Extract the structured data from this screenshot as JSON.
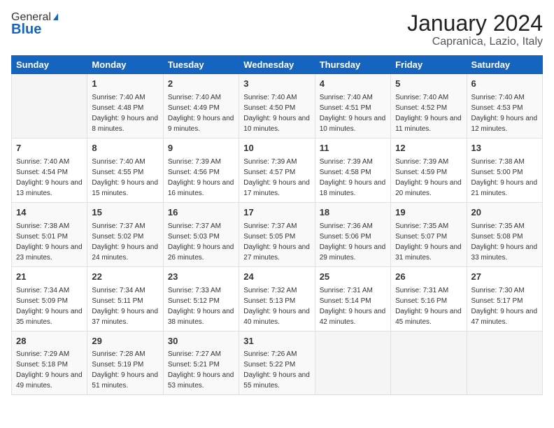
{
  "logo": {
    "general": "General",
    "blue": "Blue"
  },
  "header": {
    "month": "January 2024",
    "location": "Capranica, Lazio, Italy"
  },
  "days_of_week": [
    "Sunday",
    "Monday",
    "Tuesday",
    "Wednesday",
    "Thursday",
    "Friday",
    "Saturday"
  ],
  "weeks": [
    [
      {
        "day": "",
        "sunrise": "",
        "sunset": "",
        "daylight": ""
      },
      {
        "day": "1",
        "sunrise": "Sunrise: 7:40 AM",
        "sunset": "Sunset: 4:48 PM",
        "daylight": "Daylight: 9 hours and 8 minutes."
      },
      {
        "day": "2",
        "sunrise": "Sunrise: 7:40 AM",
        "sunset": "Sunset: 4:49 PM",
        "daylight": "Daylight: 9 hours and 9 minutes."
      },
      {
        "day": "3",
        "sunrise": "Sunrise: 7:40 AM",
        "sunset": "Sunset: 4:50 PM",
        "daylight": "Daylight: 9 hours and 10 minutes."
      },
      {
        "day": "4",
        "sunrise": "Sunrise: 7:40 AM",
        "sunset": "Sunset: 4:51 PM",
        "daylight": "Daylight: 9 hours and 10 minutes."
      },
      {
        "day": "5",
        "sunrise": "Sunrise: 7:40 AM",
        "sunset": "Sunset: 4:52 PM",
        "daylight": "Daylight: 9 hours and 11 minutes."
      },
      {
        "day": "6",
        "sunrise": "Sunrise: 7:40 AM",
        "sunset": "Sunset: 4:53 PM",
        "daylight": "Daylight: 9 hours and 12 minutes."
      }
    ],
    [
      {
        "day": "7",
        "sunrise": "Sunrise: 7:40 AM",
        "sunset": "Sunset: 4:54 PM",
        "daylight": "Daylight: 9 hours and 13 minutes."
      },
      {
        "day": "8",
        "sunrise": "Sunrise: 7:40 AM",
        "sunset": "Sunset: 4:55 PM",
        "daylight": "Daylight: 9 hours and 15 minutes."
      },
      {
        "day": "9",
        "sunrise": "Sunrise: 7:39 AM",
        "sunset": "Sunset: 4:56 PM",
        "daylight": "Daylight: 9 hours and 16 minutes."
      },
      {
        "day": "10",
        "sunrise": "Sunrise: 7:39 AM",
        "sunset": "Sunset: 4:57 PM",
        "daylight": "Daylight: 9 hours and 17 minutes."
      },
      {
        "day": "11",
        "sunrise": "Sunrise: 7:39 AM",
        "sunset": "Sunset: 4:58 PM",
        "daylight": "Daylight: 9 hours and 18 minutes."
      },
      {
        "day": "12",
        "sunrise": "Sunrise: 7:39 AM",
        "sunset": "Sunset: 4:59 PM",
        "daylight": "Daylight: 9 hours and 20 minutes."
      },
      {
        "day": "13",
        "sunrise": "Sunrise: 7:38 AM",
        "sunset": "Sunset: 5:00 PM",
        "daylight": "Daylight: 9 hours and 21 minutes."
      }
    ],
    [
      {
        "day": "14",
        "sunrise": "Sunrise: 7:38 AM",
        "sunset": "Sunset: 5:01 PM",
        "daylight": "Daylight: 9 hours and 23 minutes."
      },
      {
        "day": "15",
        "sunrise": "Sunrise: 7:37 AM",
        "sunset": "Sunset: 5:02 PM",
        "daylight": "Daylight: 9 hours and 24 minutes."
      },
      {
        "day": "16",
        "sunrise": "Sunrise: 7:37 AM",
        "sunset": "Sunset: 5:03 PM",
        "daylight": "Daylight: 9 hours and 26 minutes."
      },
      {
        "day": "17",
        "sunrise": "Sunrise: 7:37 AM",
        "sunset": "Sunset: 5:05 PM",
        "daylight": "Daylight: 9 hours and 27 minutes."
      },
      {
        "day": "18",
        "sunrise": "Sunrise: 7:36 AM",
        "sunset": "Sunset: 5:06 PM",
        "daylight": "Daylight: 9 hours and 29 minutes."
      },
      {
        "day": "19",
        "sunrise": "Sunrise: 7:35 AM",
        "sunset": "Sunset: 5:07 PM",
        "daylight": "Daylight: 9 hours and 31 minutes."
      },
      {
        "day": "20",
        "sunrise": "Sunrise: 7:35 AM",
        "sunset": "Sunset: 5:08 PM",
        "daylight": "Daylight: 9 hours and 33 minutes."
      }
    ],
    [
      {
        "day": "21",
        "sunrise": "Sunrise: 7:34 AM",
        "sunset": "Sunset: 5:09 PM",
        "daylight": "Daylight: 9 hours and 35 minutes."
      },
      {
        "day": "22",
        "sunrise": "Sunrise: 7:34 AM",
        "sunset": "Sunset: 5:11 PM",
        "daylight": "Daylight: 9 hours and 37 minutes."
      },
      {
        "day": "23",
        "sunrise": "Sunrise: 7:33 AM",
        "sunset": "Sunset: 5:12 PM",
        "daylight": "Daylight: 9 hours and 38 minutes."
      },
      {
        "day": "24",
        "sunrise": "Sunrise: 7:32 AM",
        "sunset": "Sunset: 5:13 PM",
        "daylight": "Daylight: 9 hours and 40 minutes."
      },
      {
        "day": "25",
        "sunrise": "Sunrise: 7:31 AM",
        "sunset": "Sunset: 5:14 PM",
        "daylight": "Daylight: 9 hours and 42 minutes."
      },
      {
        "day": "26",
        "sunrise": "Sunrise: 7:31 AM",
        "sunset": "Sunset: 5:16 PM",
        "daylight": "Daylight: 9 hours and 45 minutes."
      },
      {
        "day": "27",
        "sunrise": "Sunrise: 7:30 AM",
        "sunset": "Sunset: 5:17 PM",
        "daylight": "Daylight: 9 hours and 47 minutes."
      }
    ],
    [
      {
        "day": "28",
        "sunrise": "Sunrise: 7:29 AM",
        "sunset": "Sunset: 5:18 PM",
        "daylight": "Daylight: 9 hours and 49 minutes."
      },
      {
        "day": "29",
        "sunrise": "Sunrise: 7:28 AM",
        "sunset": "Sunset: 5:19 PM",
        "daylight": "Daylight: 9 hours and 51 minutes."
      },
      {
        "day": "30",
        "sunrise": "Sunrise: 7:27 AM",
        "sunset": "Sunset: 5:21 PM",
        "daylight": "Daylight: 9 hours and 53 minutes."
      },
      {
        "day": "31",
        "sunrise": "Sunrise: 7:26 AM",
        "sunset": "Sunset: 5:22 PM",
        "daylight": "Daylight: 9 hours and 55 minutes."
      },
      {
        "day": "",
        "sunrise": "",
        "sunset": "",
        "daylight": ""
      },
      {
        "day": "",
        "sunrise": "",
        "sunset": "",
        "daylight": ""
      },
      {
        "day": "",
        "sunrise": "",
        "sunset": "",
        "daylight": ""
      }
    ]
  ]
}
